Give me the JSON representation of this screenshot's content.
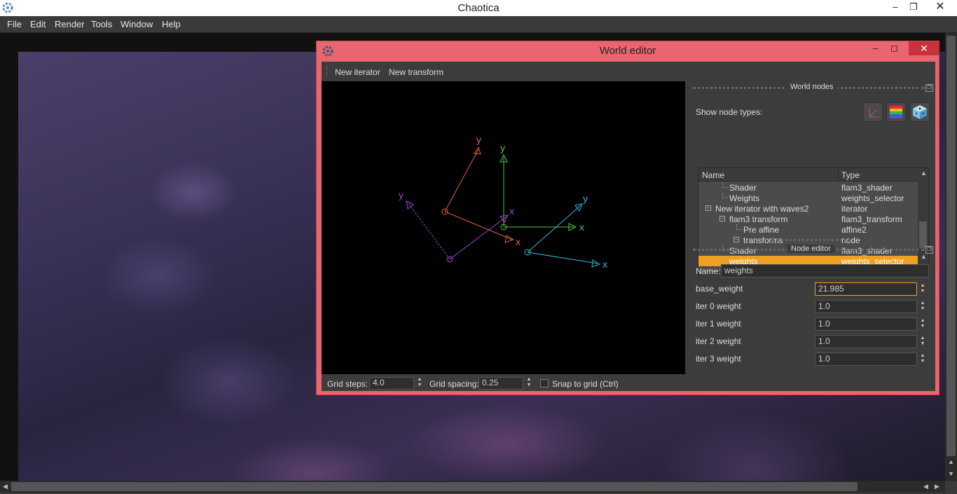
{
  "app": {
    "title": "Chaotica"
  },
  "menu": [
    "File",
    "Edit",
    "Render",
    "Tools",
    "Window",
    "Help"
  ],
  "world_editor": {
    "title": "World editor",
    "toolbar": {
      "new_iterator": "New iterator",
      "new_transform": "New transform"
    },
    "xform_labels": {
      "x": "x",
      "y": "y"
    },
    "grid": {
      "steps_label": "Grid steps:",
      "steps_value": "4.0",
      "spacing_label": "Grid spacing:",
      "spacing_value": "0.25",
      "snap_label": "Snap to grid (Ctrl)"
    },
    "world_nodes": {
      "title": "World nodes",
      "show_label": "Show node types:",
      "icons": [
        "affine-axes-icon",
        "gradient-icon",
        "dice-icon"
      ],
      "columns": [
        "Name",
        "Type"
      ],
      "rows": [
        {
          "name": "Shader",
          "type": "flam3_shader",
          "depth": 2,
          "expander": false,
          "selected": false
        },
        {
          "name": "Weights",
          "type": "weights_selector",
          "depth": 2,
          "expander": false,
          "selected": false
        },
        {
          "name": "New iterator with waves2",
          "type": "iterator",
          "depth": 1,
          "expander": true,
          "selected": false
        },
        {
          "name": "flam3 transform",
          "type": "flam3_transform",
          "depth": 2,
          "expander": true,
          "selected": false
        },
        {
          "name": "Pre affine",
          "type": "affine2",
          "depth": 3,
          "expander": false,
          "selected": false
        },
        {
          "name": "transforms",
          "type": "node",
          "depth": 3,
          "expander": true,
          "selected": false
        },
        {
          "name": "Shader",
          "type": "flam3_shader",
          "depth": 2,
          "expander": false,
          "selected": false
        },
        {
          "name": "weights",
          "type": "weights_selector",
          "depth": 2,
          "expander": false,
          "selected": true
        }
      ]
    },
    "node_editor": {
      "title": "Node editor",
      "name_label": "Name:",
      "name_value": "weights",
      "params": [
        {
          "label": "base_weight",
          "value": "21.985",
          "focused": true
        },
        {
          "label": "iter 0 weight",
          "value": "1.0",
          "focused": false
        },
        {
          "label": "iter 1 weight",
          "value": "1.0",
          "focused": false
        },
        {
          "label": "iter 2 weight",
          "value": "1.0",
          "focused": false
        },
        {
          "label": "iter 3 weight",
          "value": "1.0",
          "focused": false
        }
      ]
    }
  },
  "colors": {
    "accent_selected": "#f0a020",
    "editor_frame": "#e8666f",
    "xform_orange": "#e0643a",
    "xform_green": "#4ec84e",
    "xform_cyan": "#33b8d8",
    "xform_purple": "#a048d8"
  }
}
